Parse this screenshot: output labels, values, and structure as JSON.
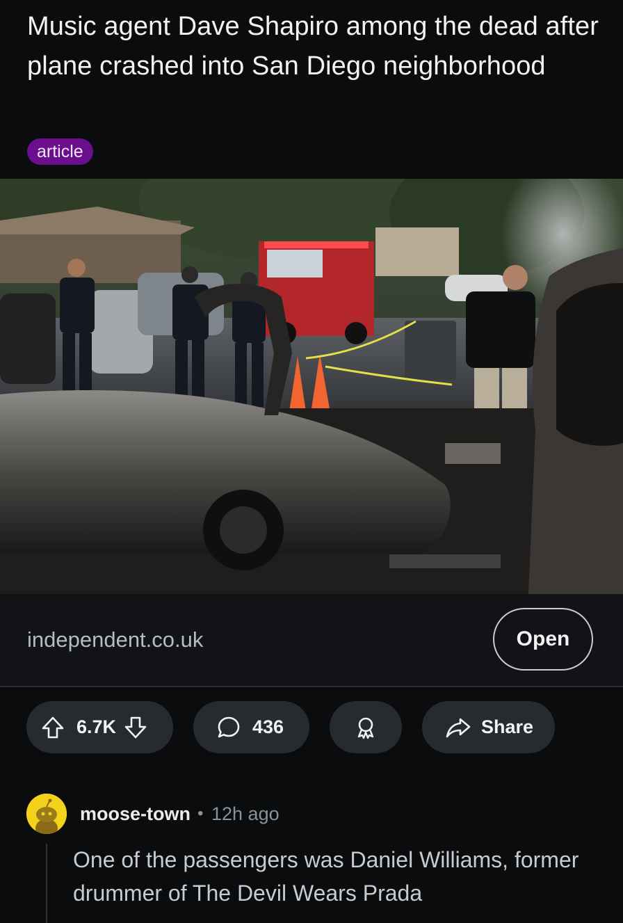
{
  "post": {
    "title": "Music agent Dave Shapiro among the dead after plane crashed into San Diego neighborhood",
    "flair": "article",
    "flair_color": "#6b0f8f",
    "image_alt_icon": "news-photo",
    "link_domain": "independent.co.uk",
    "open_label": "Open"
  },
  "actions": {
    "vote_count": "6.7K",
    "comment_count": "436",
    "share_label": "Share",
    "icons": [
      "upvote-icon",
      "downvote-icon",
      "comment-icon",
      "award-icon",
      "share-icon"
    ]
  },
  "comment": {
    "username": "moose-town",
    "separator": "•",
    "time": "12h ago",
    "text": "One of the passengers was Daniel Williams, former drummer of The Devil Wears Prada",
    "avatar_color": "#f4d21b"
  }
}
